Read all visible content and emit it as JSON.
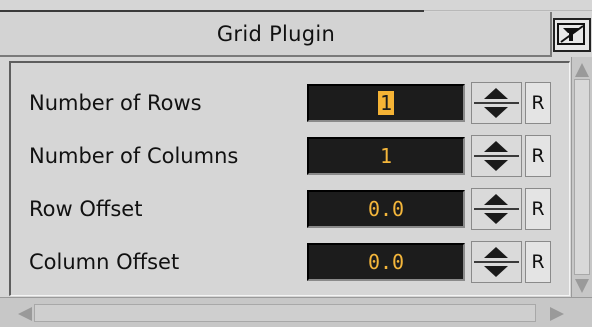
{
  "panel": {
    "title": "Grid Plugin",
    "pin_icon": "pin-icon"
  },
  "fields": [
    {
      "label": "Number of Rows",
      "value": "1",
      "selected": true,
      "reset_label": "R"
    },
    {
      "label": "Number of Columns",
      "value": "1",
      "selected": false,
      "reset_label": "R"
    },
    {
      "label": "Row Offset",
      "value": "0.0",
      "selected": false,
      "reset_label": "R"
    },
    {
      "label": "Column Offset",
      "value": "0.0",
      "selected": false,
      "reset_label": "R"
    }
  ],
  "colors": {
    "field_background": "#1c1c1c",
    "field_text": "#f4b63b",
    "selection": "#f5b335",
    "panel_background": "#d6d6d6"
  }
}
